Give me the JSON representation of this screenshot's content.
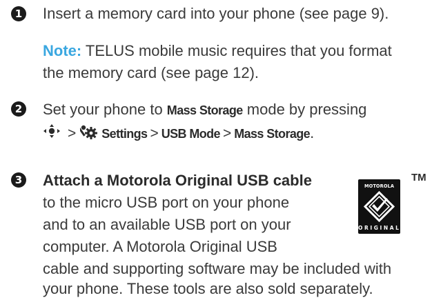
{
  "step1": {
    "number": "1",
    "text": "Insert a memory card into your phone (see page 9).",
    "note_label": "Note:",
    "note_line1": " TELUS mobile music requires that you format",
    "note_line2": "the memory card (see page 12)."
  },
  "step2": {
    "number": "2",
    "text_prefix": "Set your phone to ",
    "mode_key": "Mass Storage",
    "text_suffix": " mode by pressing",
    "nav_icon": "nav-key-icon",
    "settings_icon": "settings-gear-icon",
    "path_settings": "Settings",
    "path_usb_mode": "USB Mode",
    "path_mass_storage": "Mass Storage",
    "separator": ">",
    "end": "."
  },
  "step3": {
    "number": "3",
    "title": "Attach a Motorola Original USB cable",
    "line2": "to the micro USB port on your phone",
    "line3": "and to an available USB port on your",
    "line4": "computer. A Motorola Original USB",
    "line5": "cable and supporting software may be included with",
    "line6": "your phone. These tools are also sold separately."
  },
  "logo": {
    "top_text": "MOTOROLA",
    "bottom_text": "ORIGINAL",
    "trademark": "TM"
  },
  "colors": {
    "note_label": "#3aa7e0",
    "body_text": "#3a3a3a",
    "badge": "#1b1b1b"
  }
}
